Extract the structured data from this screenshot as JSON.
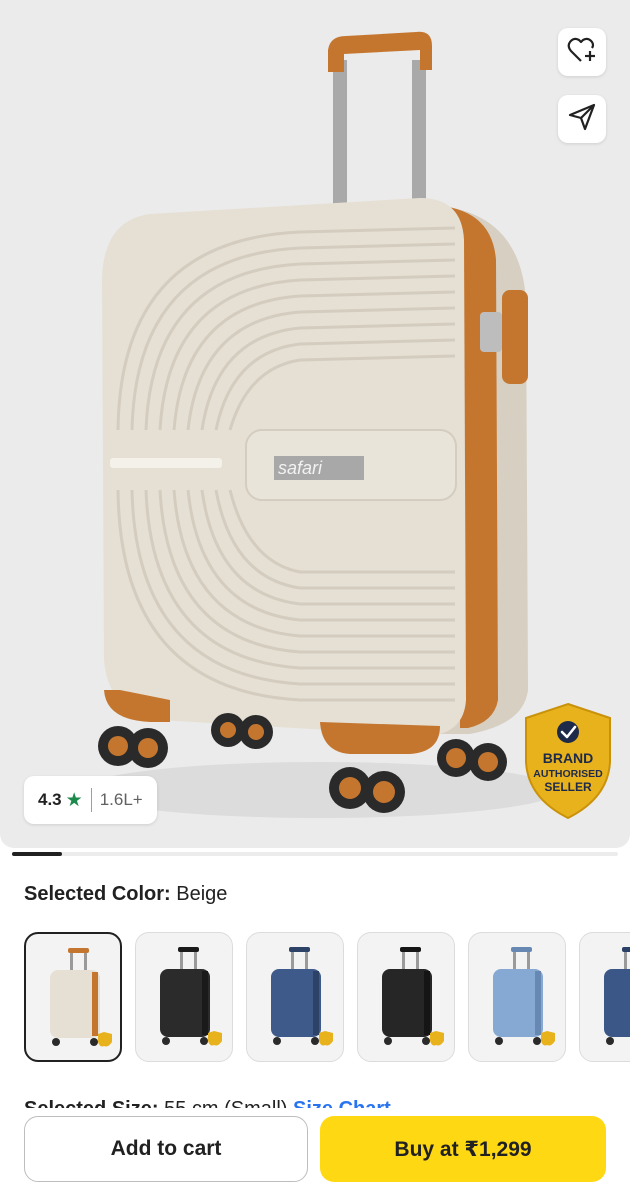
{
  "product": {
    "brand_mark": "safari",
    "rating": "4.3",
    "rating_star": "★",
    "rating_count": "1.6L+",
    "badge_lines": [
      "BRAND",
      "AUTHORISED",
      "SELLER"
    ]
  },
  "actions": {
    "wishlist_icon": "heart-plus-icon",
    "share_icon": "share-icon"
  },
  "color_selector": {
    "label": "Selected Color:",
    "value": "Beige",
    "options": [
      {
        "name": "Beige",
        "body": "#e6e0d4",
        "trim": "#c4762f",
        "selected": true
      },
      {
        "name": "Black",
        "body": "#2b2b2b",
        "trim": "#1a1a1a",
        "selected": false
      },
      {
        "name": "Navy",
        "body": "#3d5a8a",
        "trim": "#2c4266",
        "selected": false
      },
      {
        "name": "Black Front Open",
        "body": "#262626",
        "trim": "#151515",
        "selected": false
      },
      {
        "name": "Sky Blue",
        "body": "#86a9d3",
        "trim": "#6688b3",
        "selected": false
      },
      {
        "name": "Blue",
        "body": "#3b5788",
        "trim": "#2b4066",
        "selected": false
      }
    ]
  },
  "size_selector": {
    "label": "Selected Size:",
    "value": "55 cm (Small)",
    "link": "Size Chart"
  },
  "bottom_bar": {
    "add_to_cart": "Add to cart",
    "buy_now": "Buy at ₹1,299"
  },
  "colors": {
    "accent_yellow": "#ffd814",
    "rating_green": "#1b8a4a",
    "badge_gold": "#e8b21c",
    "link_blue": "#2874f0"
  }
}
